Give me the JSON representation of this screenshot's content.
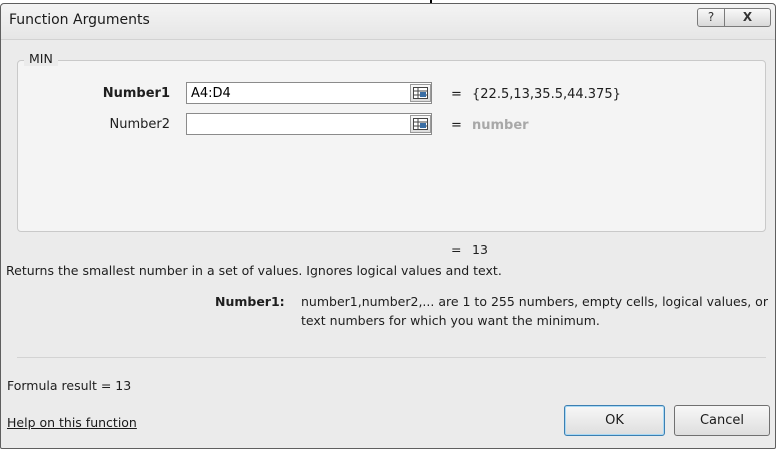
{
  "dialog": {
    "title": "Function Arguments",
    "help_glyph": "?",
    "close_glyph": "X"
  },
  "function_group": {
    "name": "MIN",
    "args": [
      {
        "label": "Number1",
        "value": "A4:D4",
        "placeholder": "",
        "result": "{22.5,13,35.5,44.375}"
      },
      {
        "label": "Number2",
        "value": "",
        "placeholder": "",
        "result": "number"
      }
    ],
    "equals_sign": "="
  },
  "result_line": {
    "equals": "=",
    "value": "13"
  },
  "description": "Returns the smallest number in a set of values. Ignores logical values and text.",
  "arg_help": {
    "label": "Number1:",
    "line1": "number1,number2,... are 1 to 255 numbers, empty cells, logical values, or",
    "line2": "text numbers for which you want the minimum."
  },
  "formula_result": "Formula result =  13",
  "help_link": "Help on this function",
  "buttons": {
    "ok": "OK",
    "cancel": "Cancel"
  },
  "icons": [
    "range-selector-icon",
    "help-icon",
    "close-icon"
  ]
}
